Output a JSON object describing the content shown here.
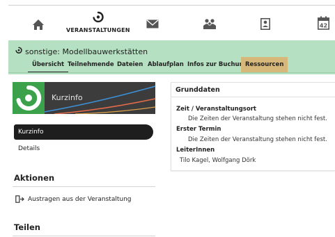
{
  "nav": {
    "items": [
      {
        "icon": "home-icon",
        "label": ""
      },
      {
        "icon": "veranstaltungen-icon",
        "label": "VERANSTALTUNGEN"
      },
      {
        "icon": "mail-icon",
        "label": ""
      },
      {
        "icon": "community-icon",
        "label": ""
      },
      {
        "icon": "profile-icon",
        "label": ""
      },
      {
        "icon": "calendar-icon",
        "label": "42"
      }
    ]
  },
  "course": {
    "title": "sonstige: Modellbauwerkstätten",
    "tabs": [
      "Übersicht",
      "Teilnehmende",
      "Dateien",
      "Ablaufplan",
      "Infos zur Buchung",
      "Ressourcen"
    ]
  },
  "sidebar": {
    "banner_label": "Kurzinfo",
    "items": [
      {
        "label": "Kurzinfo",
        "active": true
      },
      {
        "label": "Details",
        "active": false
      }
    ],
    "actions_heading": "Aktionen",
    "actions": [
      {
        "label": "Austragen aus der Veranstaltung",
        "icon": "leave-icon"
      }
    ],
    "share_heading": "Teilen"
  },
  "details": {
    "heading": "Grunddaten",
    "fields": [
      {
        "label": "Zeit / Veranstaltungsort",
        "value": "Die Zeiten der Veranstaltung stehen nicht fest."
      },
      {
        "label": "Erster Termin",
        "value": "Die Zeiten der Veranstaltung stehen nicht fest."
      },
      {
        "label": "LeiterInnen",
        "value": "Tilo Kagel, Wolfgang Dörk"
      }
    ]
  },
  "colors": {
    "banner_bg": "#b5e0c2",
    "accent_green": "#3ba24b",
    "resource_tab": "#d6b97a",
    "nav_icon": "#555555"
  }
}
